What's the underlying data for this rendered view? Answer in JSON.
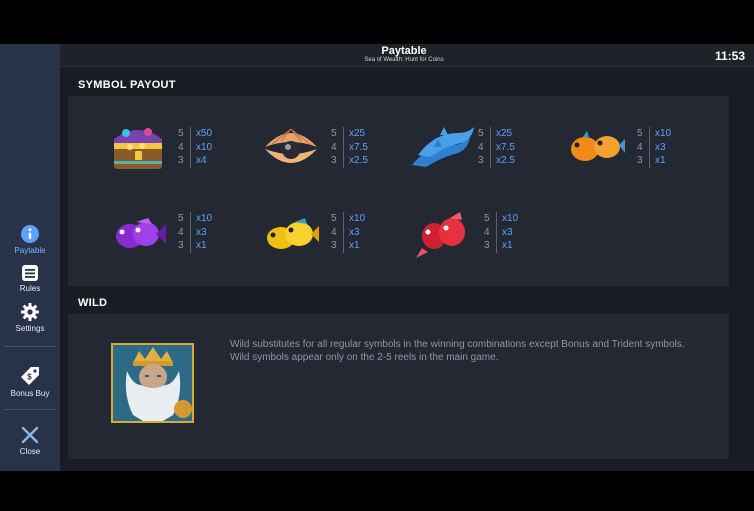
{
  "header": {
    "title": "Paytable",
    "subtitle": "Sea of Wealth: Hunt for Coins",
    "clock": "11:53"
  },
  "sidebar": {
    "items": [
      {
        "label": "Paytable",
        "icon": "info-icon",
        "active": true
      },
      {
        "label": "Rules",
        "icon": "rules-list-icon"
      },
      {
        "label": "Settings",
        "icon": "gear-icon"
      },
      {
        "label": "Bonus Buy",
        "icon": "price-tag-icon"
      },
      {
        "label": "Close",
        "icon": "close-icon"
      }
    ]
  },
  "symbol_payout": {
    "heading": "SYMBOL PAYOUT",
    "symbols": [
      {
        "name": "treasure-chest",
        "payouts": [
          {
            "count": "5",
            "mult": "x50"
          },
          {
            "count": "4",
            "mult": "x10"
          },
          {
            "count": "3",
            "mult": "x4"
          }
        ]
      },
      {
        "name": "pearl-shell",
        "payouts": [
          {
            "count": "5",
            "mult": "x25"
          },
          {
            "count": "4",
            "mult": "x7.5"
          },
          {
            "count": "3",
            "mult": "x2.5"
          }
        ]
      },
      {
        "name": "dolphins",
        "payouts": [
          {
            "count": "5",
            "mult": "x25"
          },
          {
            "count": "4",
            "mult": "x7.5"
          },
          {
            "count": "3",
            "mult": "x2.5"
          }
        ]
      },
      {
        "name": "orange-pufferfish",
        "payouts": [
          {
            "count": "5",
            "mult": "x10"
          },
          {
            "count": "4",
            "mult": "x3"
          },
          {
            "count": "3",
            "mult": "x1"
          }
        ]
      },
      {
        "name": "purple-fish",
        "payouts": [
          {
            "count": "5",
            "mult": "x10"
          },
          {
            "count": "4",
            "mult": "x3"
          },
          {
            "count": "3",
            "mult": "x1"
          }
        ]
      },
      {
        "name": "yellow-fish",
        "payouts": [
          {
            "count": "5",
            "mult": "x10"
          },
          {
            "count": "4",
            "mult": "x3"
          },
          {
            "count": "3",
            "mult": "x1"
          }
        ]
      },
      {
        "name": "red-fish",
        "payouts": [
          {
            "count": "5",
            "mult": "x10"
          },
          {
            "count": "4",
            "mult": "x3"
          },
          {
            "count": "3",
            "mult": "x1"
          }
        ]
      }
    ]
  },
  "wild": {
    "heading": "WILD",
    "symbol": "poseidon-wild",
    "line1": "Wild substitutes for all regular symbols in the winning combinations except Bonus and Trident symbols.",
    "line2": "Wild symbols appear only on the 2-5 reels in the main game."
  },
  "colors": {
    "accent": "#5fa0ff",
    "sidebar": "#28334a",
    "panel": "#232832",
    "background": "#191c22"
  }
}
